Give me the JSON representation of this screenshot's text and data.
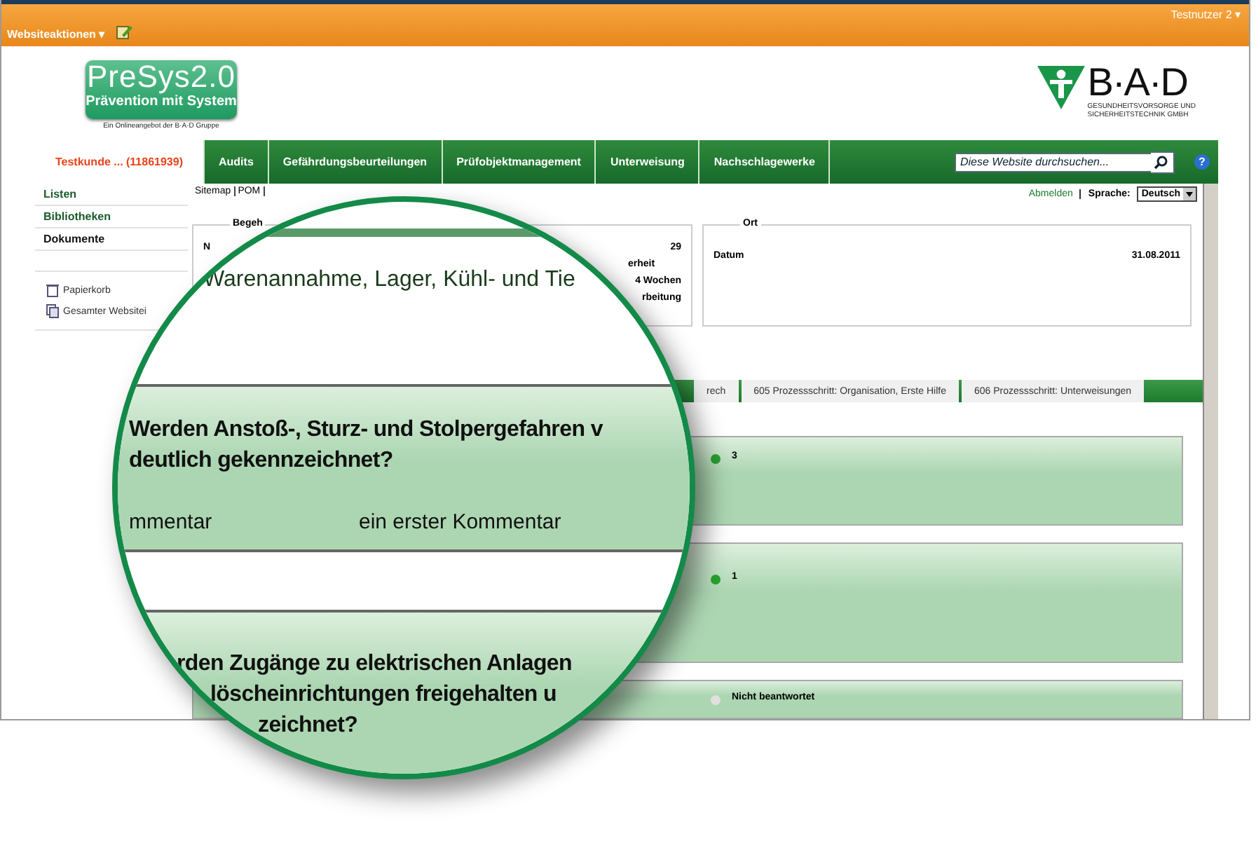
{
  "top_bar": {
    "site_actions": "Websiteaktionen",
    "user": "Testnutzer 2",
    "caret": "▾"
  },
  "header": {
    "logo_title": "PreSys2.0",
    "logo_subtitle": "Prävention mit System",
    "logo_tagline": "Ein Onlineangebot der B·A·D Gruppe",
    "brand": "B·A·D",
    "brand_line_1": "GESUNDHEITSVORSORGE UND",
    "brand_line_2": "SICHERHEITSTECHNIK GMBH"
  },
  "nav": {
    "customer": "Testkunde ... (11861939)",
    "tabs": [
      "Audits",
      "Gefährdungsbeurteilungen",
      "Prüfobjektmanagement",
      "Unterweisung",
      "Nachschlagewerke"
    ],
    "search": {
      "placeholder": "Diese Website durchsuchen..."
    },
    "help": "?"
  },
  "sidebar": {
    "items": [
      {
        "label": "Listen",
        "selected": false
      },
      {
        "label": "Bibliotheken",
        "selected": false
      },
      {
        "label": "Dokumente",
        "selected": true
      }
    ],
    "tools": [
      "Papierkorb",
      "Gesamter Websitei"
    ]
  },
  "breadcrumb": [
    "Sitemap",
    "POM"
  ],
  "account": {
    "logout": "Abmelden",
    "language_label": "Sprache:",
    "language": "Deutsch"
  },
  "left_panel": {
    "legend": "Begeh",
    "rows": [
      {
        "start": "N",
        "value": "29"
      },
      {
        "end": "erheit"
      },
      {
        "value": "4 Wochen"
      },
      {
        "value": "rbeitung"
      }
    ]
  },
  "right_panel": {
    "legend": "Ort",
    "label": "Datum",
    "value": "31.08.2011"
  },
  "section_tabs": [
    "rech",
    "605 Prozessschritt: Organisation, Erste Hilfe",
    "606 Prozessschritt: Unterweisungen"
  ],
  "answers": [
    {
      "text": "3",
      "answered": true
    },
    {
      "text": "1",
      "answered": true
    },
    {
      "text": "Nicht beantwortet",
      "answered": false
    }
  ],
  "magnifier": {
    "heading": "Warenannahme, Lager, Kühl- und Tie",
    "questions": [
      {
        "lines": [
          "Werden Anstoß-, Sturz- und Stolpergefahren v",
          "deutlich gekennzeichnet?"
        ],
        "comment_label": "mmentar",
        "comment": "ein erster Kommentar"
      },
      {
        "lines": [
          "rden Zugänge zu elektrischen Anlagen",
          "löscheinrichtungen freigehalten u",
          "zeichnet?"
        ]
      }
    ]
  }
}
